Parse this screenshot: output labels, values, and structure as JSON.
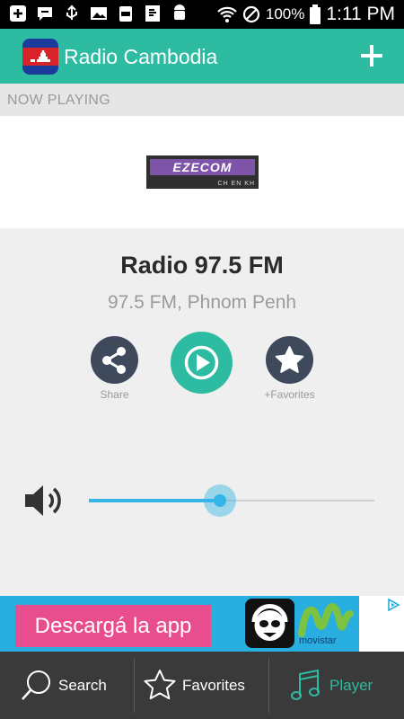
{
  "status_bar": {
    "battery_percent": "100%",
    "time": "1:11 PM"
  },
  "app_bar": {
    "title": "Radio Cambodia",
    "add_icon": "plus-icon",
    "flag_icon": "cambodia-flag-icon"
  },
  "now_playing": {
    "section_label": "NOW PLAYING",
    "logo_text": "EZECOM",
    "logo_langs": "CH EN KH",
    "station_name": "Radio 97.5 FM",
    "station_detail": "97.5 FM, Phnom Penh"
  },
  "actions": {
    "share_label": "Share",
    "favorites_label": "+Favorites"
  },
  "volume": {
    "level": 0.46
  },
  "ad": {
    "headline": "Descargá la app",
    "brand": "movistar"
  },
  "nav": {
    "search": "Search",
    "favorites": "Favorites",
    "player": "Player"
  },
  "colors": {
    "accent": "#2dbba2",
    "slider": "#33b5e5",
    "dark_button": "#3e4a5c",
    "nav_active": "#2dbba2"
  }
}
